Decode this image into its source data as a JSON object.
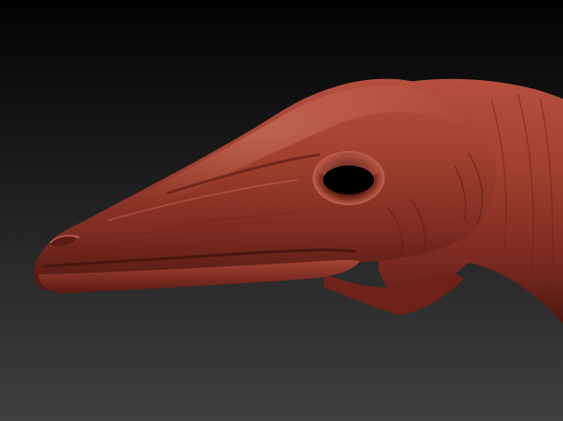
{
  "scene": {
    "subject": "dinosaur-head-sculpt",
    "background_top": "#050505",
    "background_bottom": "#3c3c3c",
    "clay_color": "#9a3a2f",
    "clay_highlight": "#c9695a",
    "clay_shadow": "#4a1510"
  }
}
